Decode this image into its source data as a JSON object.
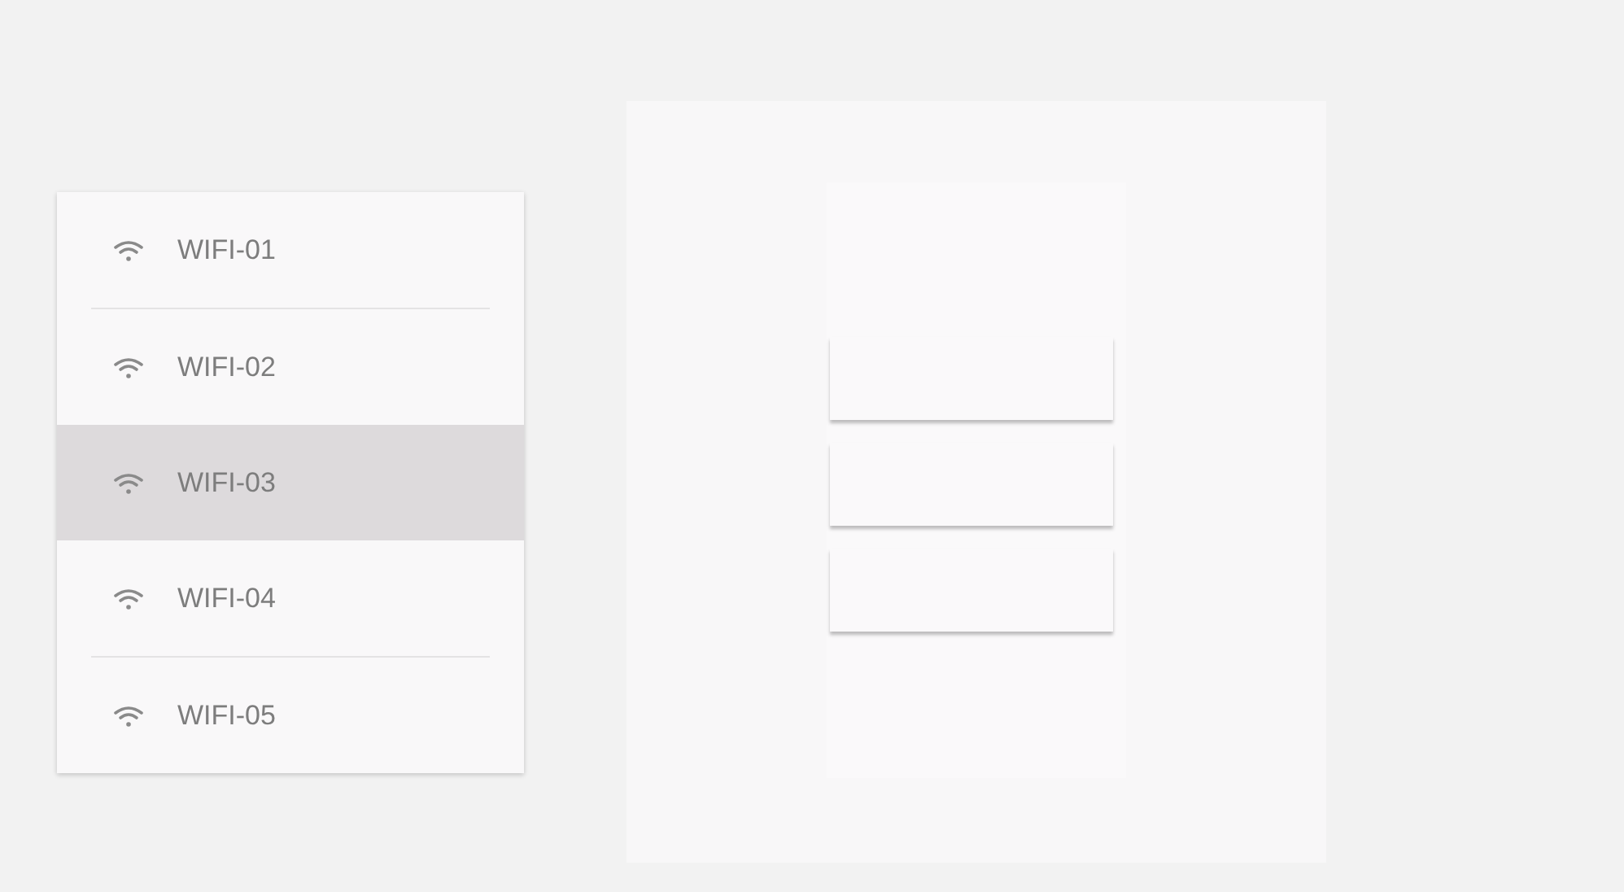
{
  "networks": [
    {
      "name": "WIFI-01",
      "selected": false
    },
    {
      "name": "WIFI-02",
      "selected": false
    },
    {
      "name": "WIFI-03",
      "selected": true
    },
    {
      "name": "WIFI-04",
      "selected": false
    },
    {
      "name": "WIFI-05",
      "selected": false
    }
  ]
}
